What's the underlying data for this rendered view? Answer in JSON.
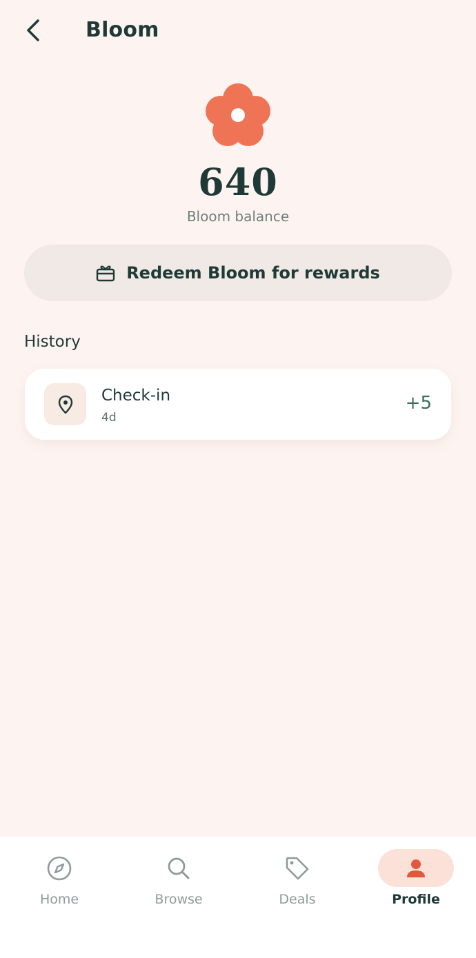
{
  "header": {
    "title": "Bloom",
    "back_icon": "chevron-left-icon"
  },
  "balance": {
    "value": "640",
    "label": "Bloom balance",
    "icon": "flower-icon",
    "accent_color": "#ee7455"
  },
  "redeem": {
    "label": "Redeem Bloom for rewards",
    "icon": "gift-card-icon"
  },
  "history": {
    "heading": "History",
    "items": [
      {
        "title": "Check-in",
        "time": "4d",
        "points": "+5",
        "icon": "location-pin-icon"
      }
    ]
  },
  "tabbar": {
    "tabs": [
      {
        "label": "Home",
        "icon": "compass-icon"
      },
      {
        "label": "Browse",
        "icon": "search-icon"
      },
      {
        "label": "Deals",
        "icon": "tag-icon"
      },
      {
        "label": "Profile",
        "icon": "person-icon"
      }
    ],
    "active_tab": "Profile",
    "active_color": "#e0593a"
  }
}
